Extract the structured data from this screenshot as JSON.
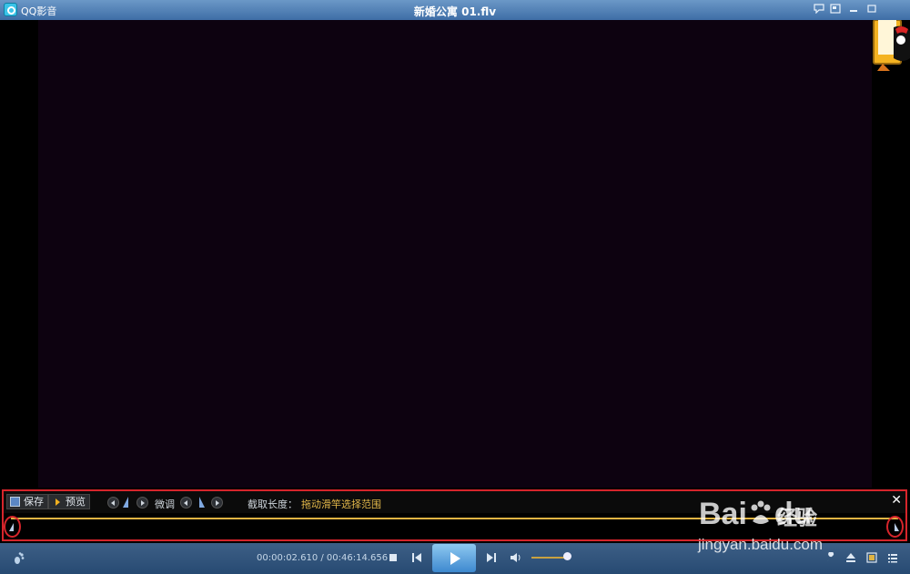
{
  "titlebar": {
    "app_name": "QQ影音",
    "file_title": "新婚公寓 01.flv",
    "buttons": [
      "chat-icon",
      "mini-mode-icon",
      "minimize-icon",
      "restore-icon"
    ]
  },
  "trim_panel": {
    "save_label": "保存",
    "preview_label": "预览",
    "fine_tune_label": "微调",
    "length_label": "截取长度：",
    "hint_text": "拖动滑竿选择范围",
    "close_glyph": "✕"
  },
  "control_bar": {
    "time_current": "00:00:02.610",
    "time_separator": " / ",
    "time_total": "00:46:14.656",
    "volume_level": 0.85
  },
  "watermark": {
    "brand": "Bai",
    "brand_suffix": "du",
    "product": "经验",
    "url": "jingyan.baidu.com"
  },
  "colors": {
    "titlebar": "#3e6da6",
    "video_bg": "#0d0210",
    "highlight_border": "#d6252b",
    "track": "#e0b443",
    "hint": "#e3b84a"
  }
}
